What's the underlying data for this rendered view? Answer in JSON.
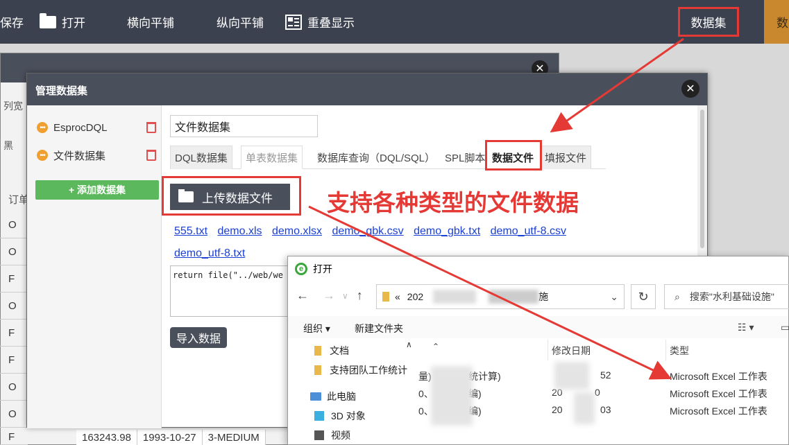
{
  "toolbar": {
    "save": "保存",
    "open": "打开",
    "tile_h": "横向平铺",
    "tile_v": "纵向平铺",
    "redisplay": "重叠显示",
    "dataset": "数据集",
    "right_cut": "数"
  },
  "bg": {
    "label_colwidth": "列宽",
    "label_black": "黑",
    "label_order": "订单",
    "cells": [
      "O",
      "O",
      "F",
      "O",
      "F",
      "F",
      "O",
      "O",
      "F"
    ],
    "bottom_row": [
      "163243.98",
      "1993-10-27",
      "3-MEDIUM"
    ]
  },
  "dialog": {
    "title": "管理数据集",
    "datasets": [
      {
        "label": "EsprocDQL"
      },
      {
        "label": "文件数据集"
      }
    ],
    "add_button": "+ 添加数据集",
    "name_value": "文件数据集",
    "tabs": [
      "DQL数据集",
      "单表数据集",
      "数据库查询（DQL/SQL）",
      "SPL脚本",
      "数据文件",
      "填报文件"
    ],
    "upload_button": "上传数据文件",
    "caption": "支持各种类型的文件数据",
    "files": [
      "555.txt",
      "demo.xls",
      "demo.xlsx",
      "demo_gbk.csv",
      "demo_gbk.txt",
      "demo_utf-8.csv",
      "demo_utf-8.txt"
    ],
    "code": "return file(\"../web/we",
    "import_button": "导入数据"
  },
  "win": {
    "title": "打开",
    "address_prefix": "«",
    "address_start": "202",
    "address_end": "施",
    "search_placeholder": "搜索\"水利基础设施\"",
    "cmd_organize": "组织 ▾",
    "cmd_newfolder": "新建文件夹",
    "nav_items": [
      "文档",
      "支持团队工作统计",
      "此电脑",
      "3D 对象",
      "视频"
    ],
    "col_modified": "修改日期",
    "col_type": "类型",
    "rows": [
      {
        "name": "量)",
        "name2": "统计算)",
        "date": "",
        "date2": "52",
        "type": "Microsoft Excel 工作表"
      },
      {
        "name": "0、",
        "name2": "编)",
        "date": "20",
        "date2": "0",
        "type": "Microsoft Excel 工作表"
      },
      {
        "name": "0、",
        "name2": "编)",
        "date": "20",
        "date2": "03",
        "type": "Microsoft Excel 工作表"
      }
    ]
  },
  "colors": {
    "toolbar_bg": "#3c4150",
    "highlight_red": "#e53935",
    "add_green": "#5cb85c",
    "link_blue": "#1a3fd4",
    "accent_orange": "#c9882e"
  }
}
